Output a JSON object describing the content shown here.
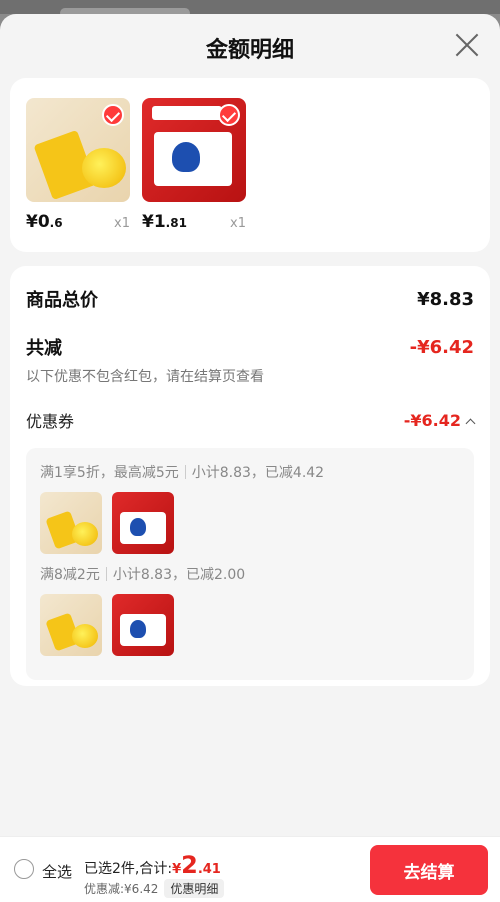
{
  "sheet": {
    "title": "金额明细"
  },
  "products": [
    {
      "price_int": "¥0",
      "price_dec": ".6",
      "qty": "x1"
    },
    {
      "price_int": "¥1",
      "price_dec": ".81",
      "qty": "x1"
    }
  ],
  "summary": {
    "total_label": "商品总价",
    "total_value": "¥8.83",
    "minus_label": "共减",
    "minus_value": "-¥6.42",
    "note": "以下优惠不包含红包，请在结算页查看",
    "coupon_label": "优惠券",
    "coupon_value": "-¥6.42"
  },
  "coupons": [
    {
      "rule": "满1享5折，最高减5元",
      "detail": "小计8.83，已减4.42"
    },
    {
      "rule": "满8减2元",
      "detail": "小计8.83，已减2.00"
    }
  ],
  "bottom": {
    "select_all": "全选",
    "selected_text": "已选2件,合计:",
    "yen": "¥",
    "amount_int": "2",
    "amount_dec": ".41",
    "discount": "优惠减:¥6.42",
    "detail_button": "优惠明细",
    "checkout": "去结算"
  },
  "colors": {
    "accent": "#f5323c",
    "discount_red": "#e5261f"
  }
}
